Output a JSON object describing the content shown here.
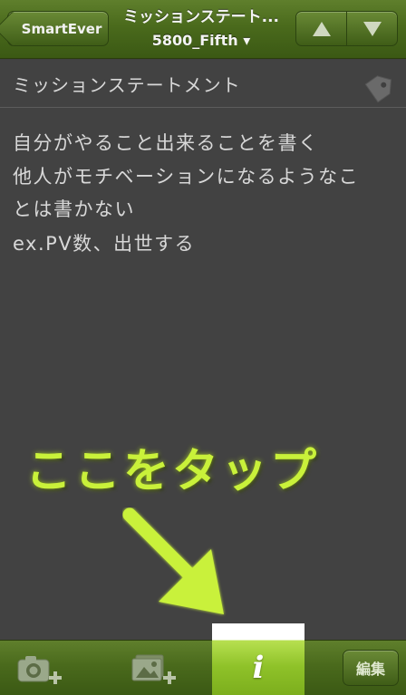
{
  "nav": {
    "back_label": "SmartEver",
    "title": "ミッションステート...",
    "notebook": "5800_Fifth ▾",
    "prev_icon": "triangle-up-icon",
    "next_icon": "triangle-down-icon"
  },
  "note": {
    "title": "ミッションステートメント",
    "tag_icon": "tag-icon",
    "body_lines": [
      "自分がやること出来ることを書く",
      "他人がモチベーションになるようなこ",
      "とは書かない",
      "ex.PV数、出世する"
    ]
  },
  "annotation": {
    "text": "ここをタップ",
    "color": "#c9f13a"
  },
  "toolbar": {
    "camera_icon": "camera-add-icon",
    "photo_icon": "photo-add-icon",
    "info_label": "i",
    "edit_label": "編集"
  },
  "colors": {
    "bar_green": "#4a6a1c",
    "highlight_green": "#8fc229",
    "content_bg": "#424242"
  }
}
